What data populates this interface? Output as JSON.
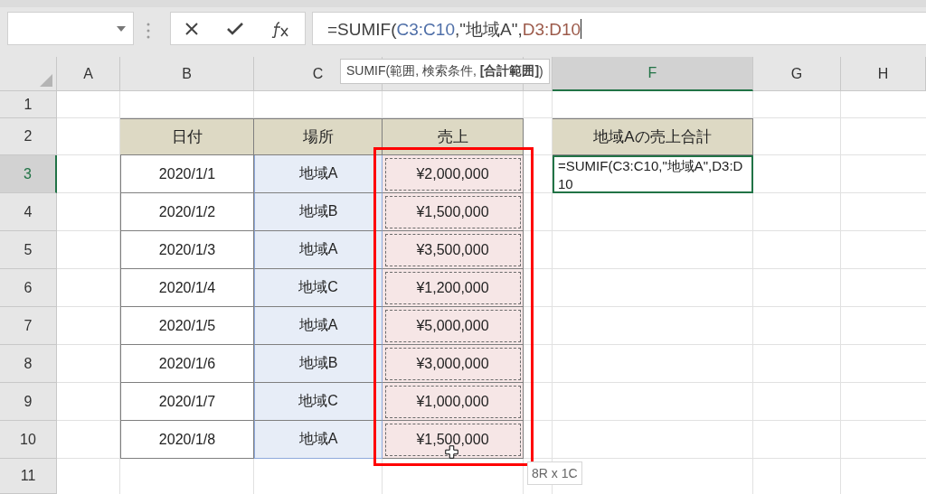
{
  "formula_bar": {
    "parts": [
      {
        "text": "=SUMIF(",
        "color": "#404040"
      },
      {
        "text": "C3:C10",
        "color": "#4f6fa8"
      },
      {
        "text": ",\"地域A\",",
        "color": "#404040"
      },
      {
        "text": "D3:D10",
        "color": "#9c5a4a"
      }
    ]
  },
  "formula_tooltip": "SUMIF(範囲, 検索条件, **[合計範囲]**)",
  "columns": [
    {
      "label": "A",
      "selected": false
    },
    {
      "label": "B",
      "selected": false
    },
    {
      "label": "C",
      "selected": false
    },
    {
      "selected": false
    },
    {
      "selected": false
    },
    {
      "label": "F",
      "selected": true
    },
    {
      "label": "G",
      "selected": false
    },
    {
      "label": "H",
      "selected": false
    }
  ],
  "rows": [
    {
      "label": "1",
      "selected": false
    },
    {
      "label": "2",
      "selected": false
    },
    {
      "label": "3",
      "selected": true
    },
    {
      "label": "4",
      "selected": false
    },
    {
      "label": "5",
      "selected": false
    },
    {
      "label": "6",
      "selected": false
    },
    {
      "label": "7",
      "selected": false
    },
    {
      "label": "8",
      "selected": false
    },
    {
      "label": "9",
      "selected": false
    },
    {
      "label": "10",
      "selected": false
    },
    {
      "label": "11",
      "selected": false
    }
  ],
  "table": {
    "columns": [
      "日付",
      "場所",
      "売上"
    ],
    "rows": [
      [
        "2020/1/1",
        "地域A",
        "¥2,000,000"
      ],
      [
        "2020/1/2",
        "地域B",
        "¥1,500,000"
      ],
      [
        "2020/1/3",
        "地域A",
        "¥3,500,000"
      ],
      [
        "2020/1/4",
        "地域C",
        "¥1,200,000"
      ],
      [
        "2020/1/5",
        "地域A",
        "¥5,000,000"
      ],
      [
        "2020/1/6",
        "地域B",
        "¥3,000,000"
      ],
      [
        "2020/1/7",
        "地域C",
        "¥1,000,000"
      ],
      [
        "2020/1/8",
        "地域A",
        "¥1,500,000"
      ]
    ]
  },
  "summary": {
    "header": "地域Aの売上合計",
    "editing_cell": "=SUMIF(C3:C10,\"地域A\",D3:D10"
  },
  "selection_size": "8R x 1C"
}
